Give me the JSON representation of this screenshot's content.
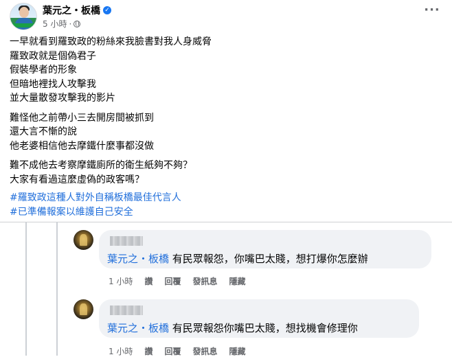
{
  "post": {
    "author": "葉元之・板橋",
    "time": "5 小時",
    "paragraphs": [
      [
        "一早就看到羅致政的粉絲來我臉書對我人身威脅",
        "羅致政就是個偽君子",
        "假裝學者的形象",
        "但暗地裡找人攻擊我",
        "並大量散發攻擊我的影片"
      ],
      [
        "難怪他之前帶小三去開房間被抓到",
        "還大言不慚的說",
        "他老婆相信他去摩鐵什麼事都沒做"
      ],
      [
        "難不成他去考察摩鐵廁所的衛生紙夠不夠？",
        "大家有看過這麼虛偽的政客嗎？"
      ]
    ],
    "hashtags": [
      "#羅致政這種人對外自稱板橋最佳代言人",
      "#已準備報案以維護自己安全"
    ]
  },
  "comments": [
    {
      "mention": "葉元之・板橋",
      "text": "有民眾報怨，你嘴巴太賤，想打爆你怎麼辦",
      "time": "1 小時",
      "actions": [
        "讚",
        "回覆",
        "發訊息",
        "隱藏"
      ]
    },
    {
      "mention": "葉元之・板橋",
      "text": "有民眾報怨你嘴巴太賤，想找機會修理你",
      "time": "1 小時",
      "actions": [
        "讚",
        "回覆",
        "發訊息",
        "隱藏"
      ]
    }
  ],
  "icons": {
    "verified": "verified-badge-icon",
    "privacy": "globe-icon",
    "more": "more-options-icon"
  },
  "colors": {
    "link": "#216fdb",
    "verified": "#1877f2",
    "bubble": "#f0f2f5",
    "meta": "#65676b"
  }
}
